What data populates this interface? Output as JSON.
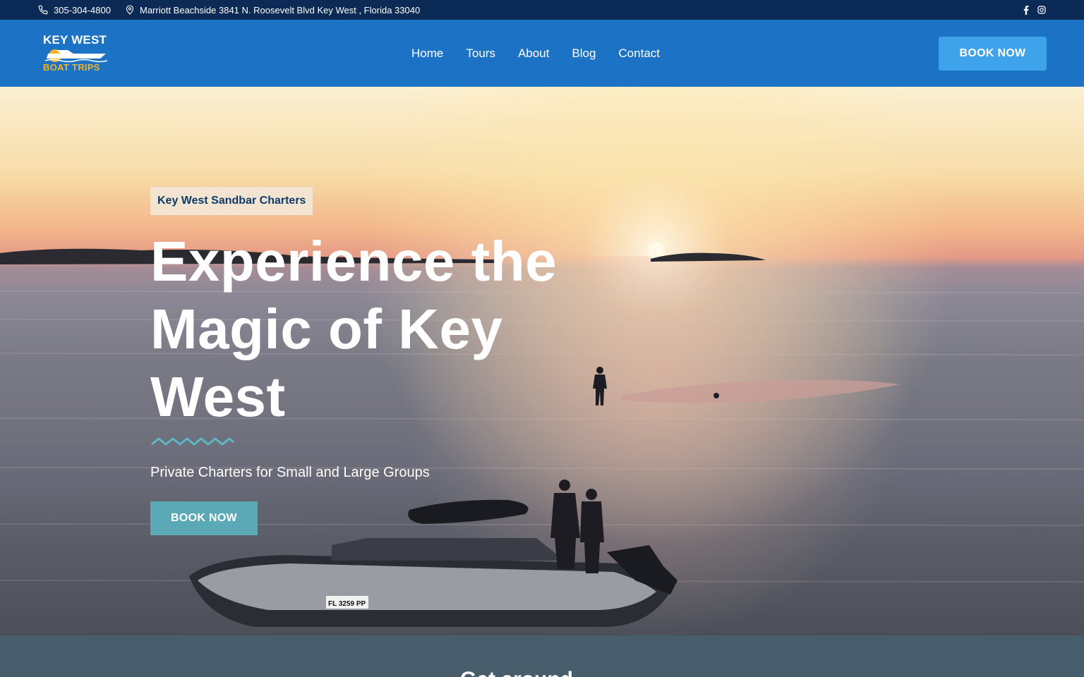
{
  "topbar": {
    "phone": "305-304-4800",
    "address": "Marriott Beachside 3841 N. Roosevelt Blvd Key West , Florida 33040",
    "phone_icon": "phone-icon",
    "location_icon": "map-pin-icon",
    "social_icons": [
      "facebook-icon",
      "instagram-icon"
    ]
  },
  "header": {
    "logo_line1": "KEY WEST",
    "logo_line2": "BOAT TRIPS",
    "nav": [
      "Home",
      "Tours",
      "About",
      "Blog",
      "Contact"
    ],
    "cta": "BOOK NOW"
  },
  "hero": {
    "tag": "Key West Sandbar Charters",
    "title": "Experience the Magic of Key West",
    "subtitle": "Private Charters for Small and Large Groups",
    "cta": "BOOK NOW",
    "boat_registration": "FL 3259 PP"
  },
  "band": {
    "peek": "Get around"
  },
  "colors": {
    "topbar": "#0b2a55",
    "header": "#1c72c4",
    "header_button": "#3ea3ea",
    "hero_button": "#5ba9b7",
    "tag_text": "#0e3a66",
    "band": "#485d6b"
  }
}
